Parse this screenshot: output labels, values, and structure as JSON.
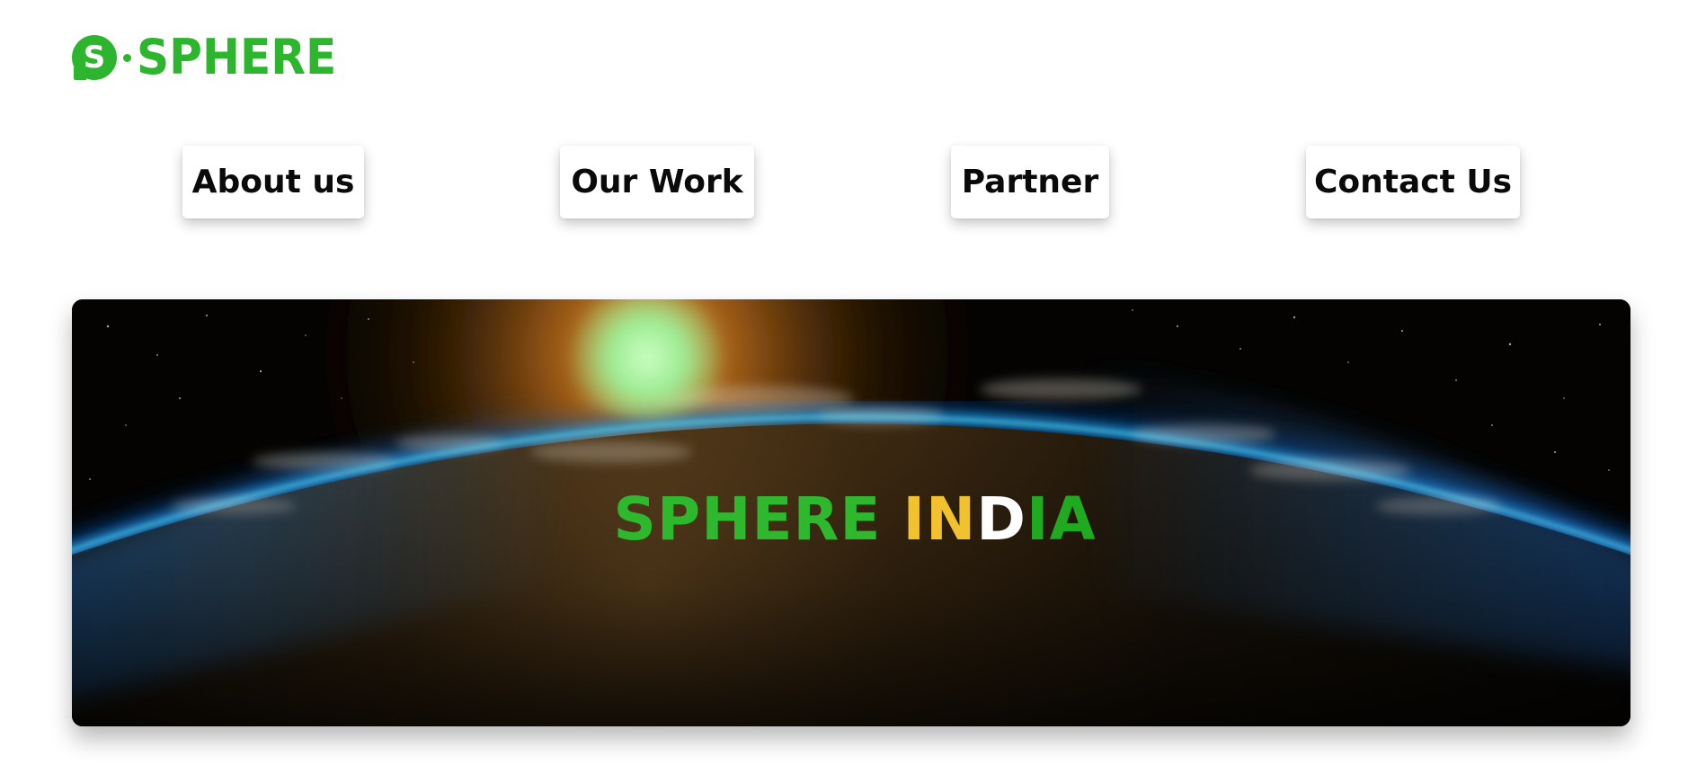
{
  "brand": {
    "logo_letter": "S",
    "logo_text": "SPHERE",
    "color": "#2db52d"
  },
  "nav": {
    "items": [
      {
        "label": "About us"
      },
      {
        "label": "Our Work"
      },
      {
        "label": "Partner"
      },
      {
        "label": "Contact Us"
      }
    ]
  },
  "hero": {
    "image": "earth-from-space-sunrise",
    "title_part1": "SPHERE",
    "title_part2_in": "IN",
    "title_part2_d": "D",
    "title_part2_ia": "IA",
    "colors": {
      "sphere": "#2eb82e",
      "saffron": "#f2c12e",
      "white": "#ffffff",
      "green": "#1faa1f"
    }
  }
}
